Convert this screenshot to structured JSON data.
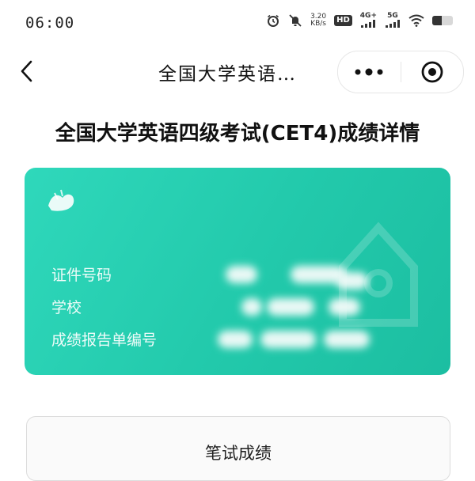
{
  "status_bar": {
    "time": "06:00",
    "net_speed_value": "3.20",
    "net_speed_unit": "KB/s",
    "hd_label": "HD",
    "signal1_label": "4G+",
    "signal2_label": "5G",
    "battery_level": 0.45
  },
  "nav": {
    "title": "全国大学英语…"
  },
  "page": {
    "heading": "全国大学英语四级考试(CET4)成绩详情"
  },
  "card": {
    "accent_color": "#22c9ab",
    "rows": [
      {
        "label": "证件号码"
      },
      {
        "label": "学校"
      },
      {
        "label": "成绩报告单编号"
      }
    ]
  },
  "score_section": {
    "title": "笔试成绩"
  },
  "icons": {
    "back": "chevron-left-icon",
    "menu": "more-dots-icon",
    "close": "target-circle-icon",
    "alarm": "alarm-icon",
    "mute": "mute-bell-icon",
    "wifi": "wifi-icon",
    "battery": "battery-icon"
  }
}
